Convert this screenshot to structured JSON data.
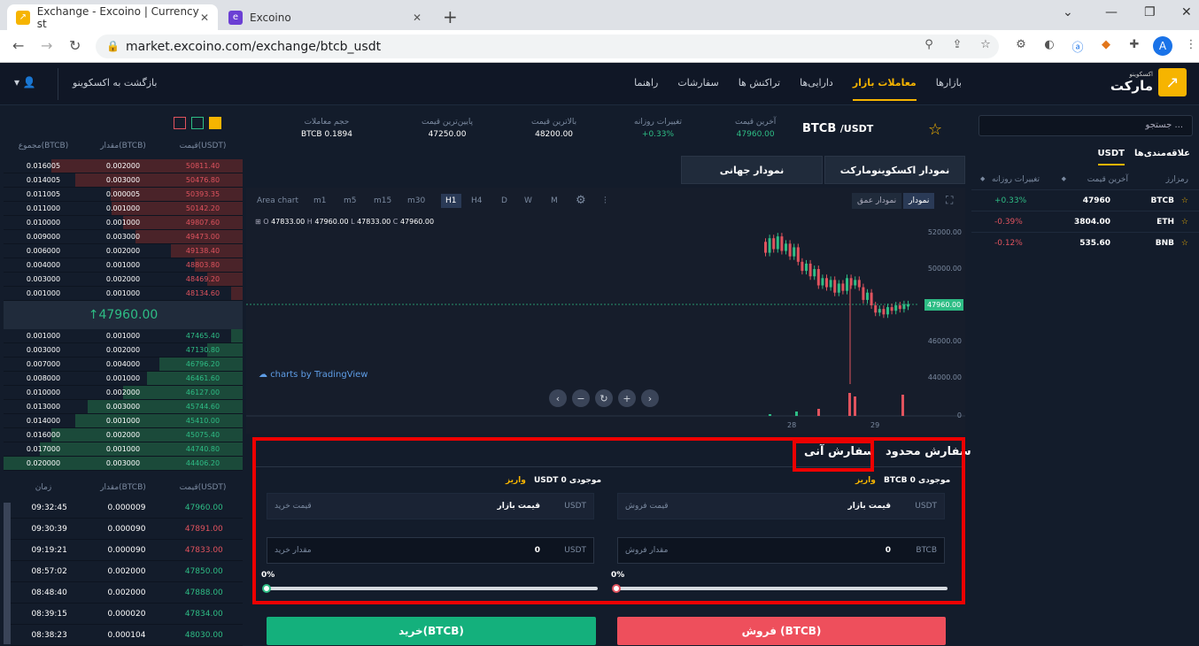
{
  "browser": {
    "tabs": [
      {
        "title": "Exchange - Excoino | Currency st",
        "active": true
      },
      {
        "title": "Excoino",
        "active": false
      }
    ],
    "url": "market.excoino.com/exchange/btcb_usdt",
    "profile_initial": "A"
  },
  "header": {
    "logo_small": "اکسکوینو",
    "logo_big": "مارکت",
    "nav": [
      "بازارها",
      "معاملات بازار",
      "دارایی‌ها",
      "تراکنش ها",
      "سفارشات",
      "راهنما"
    ],
    "active_nav": "معاملات بازار",
    "back_link": "بازگشت به اکسکوینو"
  },
  "orderbook": {
    "columns": [
      "قیمت(USDT)",
      "مقدار(BTCB)",
      "مجموع(BTCB)"
    ],
    "asks": [
      {
        "price": "50811.40",
        "amount": "0.002000",
        "total": "0.016005"
      },
      {
        "price": "50476.80",
        "amount": "0.003000",
        "total": "0.014005"
      },
      {
        "price": "50393.35",
        "amount": "0.000005",
        "total": "0.011005"
      },
      {
        "price": "50142.20",
        "amount": "0.001000",
        "total": "0.011000"
      },
      {
        "price": "49807.60",
        "amount": "0.001000",
        "total": "0.010000"
      },
      {
        "price": "49473.00",
        "amount": "0.003000",
        "total": "0.009000"
      },
      {
        "price": "49138.40",
        "amount": "0.002000",
        "total": "0.006000"
      },
      {
        "price": "48803.80",
        "amount": "0.001000",
        "total": "0.004000"
      },
      {
        "price": "48469.20",
        "amount": "0.002000",
        "total": "0.003000"
      },
      {
        "price": "48134.60",
        "amount": "0.001000",
        "total": "0.001000"
      }
    ],
    "mid_price": "↑47960.00",
    "bids": [
      {
        "price": "47465.40",
        "amount": "0.001000",
        "total": "0.001000"
      },
      {
        "price": "47130.80",
        "amount": "0.002000",
        "total": "0.003000"
      },
      {
        "price": "46796.20",
        "amount": "0.004000",
        "total": "0.007000"
      },
      {
        "price": "46461.60",
        "amount": "0.001000",
        "total": "0.008000"
      },
      {
        "price": "46127.00",
        "amount": "0.002000",
        "total": "0.010000"
      },
      {
        "price": "45744.60",
        "amount": "0.003000",
        "total": "0.013000"
      },
      {
        "price": "45410.00",
        "amount": "0.001000",
        "total": "0.014000"
      },
      {
        "price": "45075.40",
        "amount": "0.002000",
        "total": "0.016000"
      },
      {
        "price": "44740.80",
        "amount": "0.001000",
        "total": "0.017000"
      },
      {
        "price": "44406.20",
        "amount": "0.003000",
        "total": "0.020000"
      }
    ]
  },
  "trades": {
    "columns": [
      "قیمت(USDT)",
      "مقدار(BTCB)",
      "زمان"
    ],
    "rows": [
      {
        "price": "47960.00",
        "amount": "0.000009",
        "time": "09:32:45",
        "side": "buy"
      },
      {
        "price": "47891.00",
        "amount": "0.000090",
        "time": "09:30:39",
        "side": "sell"
      },
      {
        "price": "47833.00",
        "amount": "0.000090",
        "time": "09:19:21",
        "side": "sell"
      },
      {
        "price": "47850.00",
        "amount": "0.002000",
        "time": "08:57:02",
        "side": "buy"
      },
      {
        "price": "47888.00",
        "amount": "0.002000",
        "time": "08:48:40",
        "side": "buy"
      },
      {
        "price": "47834.00",
        "amount": "0.000020",
        "time": "08:39:15",
        "side": "buy"
      },
      {
        "price": "48030.00",
        "amount": "0.000104",
        "time": "08:38:23",
        "side": "buy"
      }
    ]
  },
  "stats": {
    "pair_base": "BTCB",
    "pair_quote": "/USDT",
    "last_price_label": "آخرین قیمت",
    "last_price": "47960.00",
    "daily_change_label": "تغییرات روزانه",
    "daily_change": "+0.33%",
    "high_label": "بالاترین قیمت",
    "high": "48200.00",
    "low_label": "پایین‌ترین قیمت",
    "low": "47250.00",
    "volume_label": "حجم معاملات",
    "volume": "BTCB 0.1894"
  },
  "chart_tabs": {
    "excoino": "نمودار اکسکوینومارکت",
    "global": "نمودار جهانی"
  },
  "chart": {
    "timeframes": [
      "Area chart",
      "m1",
      "m5",
      "m15",
      "m30",
      "H1",
      "H4",
      "D",
      "W",
      "M"
    ],
    "active_tf": "H1",
    "mode_chart": "نمودار",
    "mode_depth": "نمودار عمق",
    "ohlc": {
      "o": "47833.00",
      "h": "47960.00",
      "l": "47833.00",
      "c": "47960.00"
    },
    "y_ticks": [
      "52000.00",
      "50000.00",
      "48000.00",
      "46000.00",
      "44000.00",
      "0"
    ],
    "x_ticks": [
      "28",
      "29"
    ],
    "last_tag": "47960.00",
    "brand": "charts by TradingView"
  },
  "order": {
    "tab_limit": "سفارش محدود",
    "tab_market": "سفارش آنی",
    "sell": {
      "balance_label": "موجودی",
      "balance": "BTCB 0",
      "deposit": "واریز",
      "price_unit": "USDT",
      "price_value": "قیمت بازار",
      "price_placeholder": "قیمت فروش",
      "amount_unit": "BTCB",
      "amount_value": "0",
      "amount_placeholder": "مقدار فروش",
      "pct": "0%",
      "button": "فروش (BTCB)"
    },
    "buy": {
      "balance_label": "موجودی",
      "balance": "USDT 0",
      "deposit": "واریز",
      "price_unit": "USDT",
      "price_value": "قیمت بازار",
      "price_placeholder": "قیمت خرید",
      "amount_unit": "USDT",
      "amount_value": "0",
      "amount_placeholder": "مقدار خرید",
      "pct": "0%",
      "button": "خرید(BTCB)"
    }
  },
  "markets": {
    "search_placeholder": "جستجو ...",
    "tabs": [
      "علاقه‌مندی‌ها",
      "USDT"
    ],
    "active_tab": "USDT",
    "columns": [
      "رمزارز",
      "آخرین قیمت",
      "تغییرات روزانه"
    ],
    "rows": [
      {
        "symbol": "BTCB",
        "price": "47960",
        "change": "+0.33%",
        "up": true
      },
      {
        "symbol": "ETH",
        "price": "3804.00",
        "change": "-0.39%",
        "up": false
      },
      {
        "symbol": "BNB",
        "price": "535.60",
        "change": "-0.12%",
        "up": false
      }
    ]
  },
  "colors": {
    "up": "#2ebd85",
    "down": "#e0535e",
    "accent": "#f6b400"
  }
}
